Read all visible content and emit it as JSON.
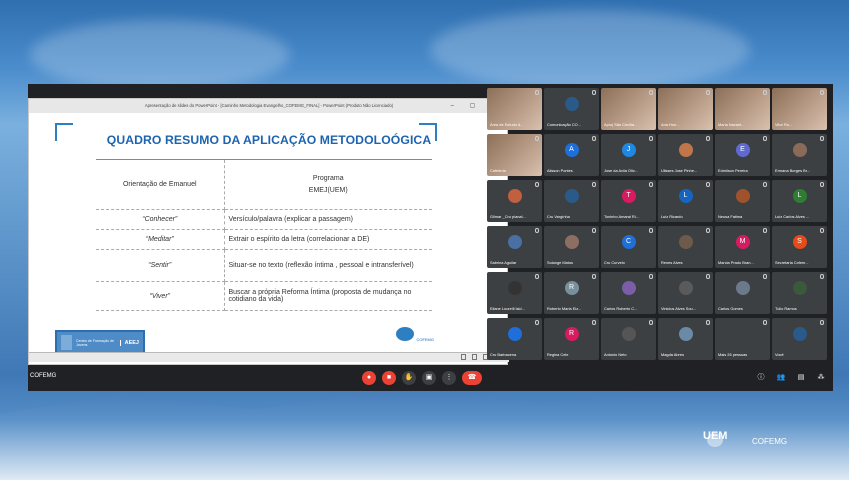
{
  "window": {
    "title": "Apresentação de slides do PowerPoint - [Caminho Metodologia Evangelho_COFEMG_FINAL] - PowerPoint (Produto Não Licenciado)",
    "controls": "– ▢ ✕"
  },
  "slide": {
    "title": "QUADRO RESUMO DA APLICAÇÃO METODOLOÓGICA",
    "header": {
      "col1": "Orientação de Emanuel",
      "col2_line1": "Programa",
      "col2_line2": "EMEJ(UEM)"
    },
    "rows": [
      {
        "col1": "“Conhecer”",
        "col2": "Versículo/palavra (explicar a passagem)"
      },
      {
        "col1": "“Meditar”",
        "col2": "Extrair o espírito da letra (correlacionar  a DE)"
      },
      {
        "col1": "“Sentir”",
        "col2": "Situar-se no texto (reflexão íntima , pessoal e intransferível)"
      },
      {
        "col1": "“Viver”",
        "col2": "Buscar a própria Reforma Íntima  (proposta de mudança no cotidiano da vida)"
      }
    ],
    "logo_left_text": "Centro de Formação de Jovens",
    "logo_left_label": "AEEJ",
    "logo_right_text": "COFEMG"
  },
  "participants": [
    {
      "name": "Área de Estudo d...",
      "photo": true
    },
    {
      "name": "Comunicação CO...",
      "initial": "",
      "color": "#2a5a8a"
    },
    {
      "name": "Aproj São Cecília...",
      "photo": true
    },
    {
      "name": "Ana Hon...",
      "photo": true
    },
    {
      "name": "Maria Nazaré...",
      "photo": true
    },
    {
      "name": "Vitor Ro...",
      "photo": true
    },
    {
      "name": "Cafeteria",
      "photo": true
    },
    {
      "name": "Alisson Pontes",
      "initial": "A",
      "color": "#1e6fd9"
    },
    {
      "name": "Jose da Avila Oliv...",
      "initial": "J",
      "color": "#1e88e5"
    },
    {
      "name": "Ulisses Jose Pinhe...",
      "initial": "",
      "color": "#c0764a"
    },
    {
      "name": "Edmilson Pereira",
      "initial": "E",
      "color": "#5e6ad2"
    },
    {
      "name": "Ermana Borges Br...",
      "initial": "",
      "color": "#8a6b5a"
    },
    {
      "name": "Gilmar _Cru planal...",
      "initial": "",
      "color": "#c06040"
    },
    {
      "name": "Cru Vargínha",
      "initial": "",
      "color": "#2a5a8a"
    },
    {
      "name": "Toninho Amaral Ri...",
      "initial": "T",
      "color": "#d81b60"
    },
    {
      "name": "Luiz Ricardo",
      "initial": "L",
      "color": "#1565c0"
    },
    {
      "name": "Neusa Fatima",
      "initial": "",
      "color": "#a0522d"
    },
    {
      "name": "Luiz Carlos Alves ...",
      "initial": "L",
      "color": "#2e7d32"
    },
    {
      "name": "Sabrina Aguilar",
      "initial": "",
      "color": "#4a6fa5"
    },
    {
      "name": "Solange Matos",
      "initial": "",
      "color": "#8d6e63"
    },
    {
      "name": "Cru Curvelo",
      "initial": "C",
      "color": "#1e6fd9"
    },
    {
      "name": "Renes Alves",
      "initial": "",
      "color": "#6d5a4a"
    },
    {
      "name": "Marcia Prado Bran...",
      "initial": "M",
      "color": "#d81b60"
    },
    {
      "name": "Secretaria Cofem...",
      "initial": "S",
      "color": "#e64a19"
    },
    {
      "name": "Eliane Lourelli Isid...",
      "initial": "",
      "color": "#333333"
    },
    {
      "name": "Roberto Maria Eiz...",
      "initial": "R",
      "color": "#78909c"
    },
    {
      "name": "Carlos Roberto C...",
      "initial": "",
      "color": "#7b5ea7"
    },
    {
      "name": "Vinicius Alves Sou...",
      "initial": "",
      "color": "#5a5a5a"
    },
    {
      "name": "Carlos Gomes",
      "initial": "",
      "color": "#6a7a8a"
    },
    {
      "name": "Tulio Ramos",
      "initial": "",
      "color": "#3b5a3b"
    },
    {
      "name": "Cru Barbacena",
      "initial": "",
      "color": "#1e6fd9"
    },
    {
      "name": "Regina Cele",
      "initial": "R",
      "color": "#d81b60"
    },
    {
      "name": "Antonio Neto",
      "initial": "",
      "color": "#555555"
    },
    {
      "name": "Magda Abreu",
      "initial": "",
      "color": "#6a8aa8"
    },
    {
      "name": "Mais 26 pessoas",
      "initial": "",
      "color": "#3c4043"
    },
    {
      "name": "Você",
      "initial": "",
      "color": "#2a5a8a"
    }
  ],
  "bottombar": {
    "meeting_name": "COFEMG",
    "controls": [
      "mic-off",
      "cam-off",
      "hand",
      "present",
      "more",
      "end-call"
    ],
    "right": [
      "info",
      "people",
      "chat",
      "activities"
    ]
  },
  "brand": {
    "uem": "UEM",
    "cofemg": "COFEMG"
  }
}
